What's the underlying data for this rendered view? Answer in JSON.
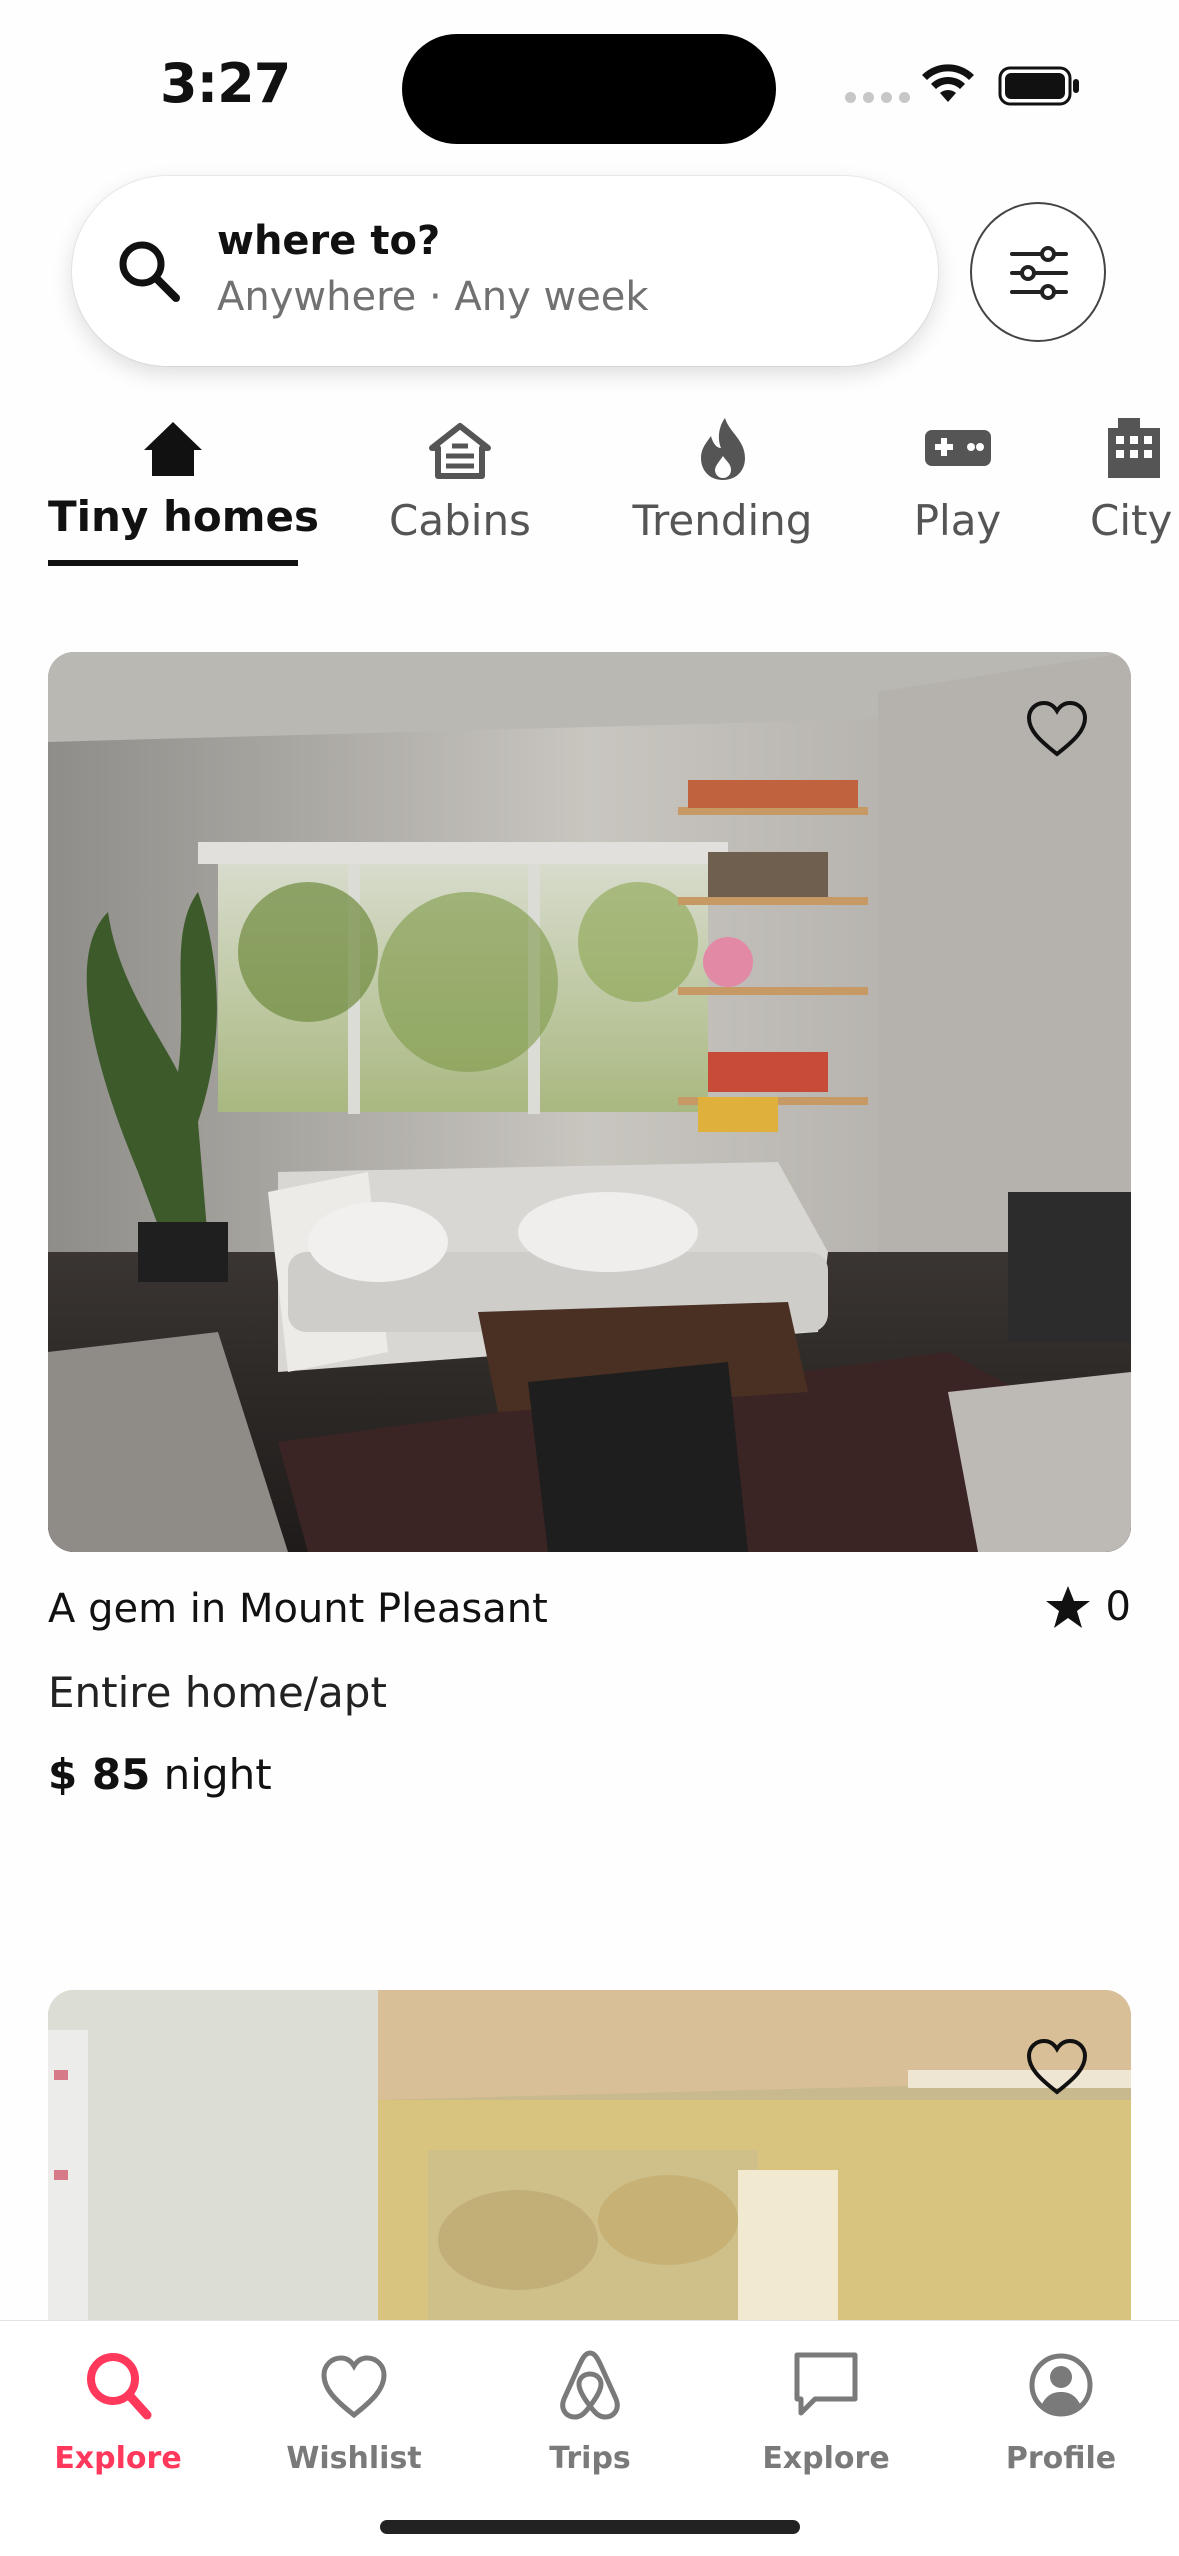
{
  "status_bar": {
    "time": "3:27"
  },
  "search": {
    "title": "where to?",
    "subtitle": "Anywhere · Any week"
  },
  "categories": [
    {
      "label": "Tiny homes",
      "icon": "home-icon",
      "active": true
    },
    {
      "label": "Cabins",
      "icon": "cabin-icon",
      "active": false
    },
    {
      "label": "Trending",
      "icon": "fire-icon",
      "active": false
    },
    {
      "label": "Play",
      "icon": "gamepad-icon",
      "active": false
    },
    {
      "label": "City",
      "icon": "city-icon",
      "active": false
    }
  ],
  "listings": [
    {
      "title": "A gem in Mount Pleasant",
      "rating": "0",
      "room_type": "Entire home/apt",
      "price": "$ 85",
      "price_unit": "night"
    },
    {
      "title": "",
      "rating": "",
      "room_type": "",
      "price": "",
      "price_unit": ""
    }
  ],
  "tab_bar": {
    "tabs": [
      {
        "label": "Explore",
        "icon": "search-icon",
        "active": true
      },
      {
        "label": "Wishlist",
        "icon": "heart-icon",
        "active": false
      },
      {
        "label": "Trips",
        "icon": "airbnb-logo-icon",
        "active": false
      },
      {
        "label": "Explore",
        "icon": "message-icon",
        "active": false
      },
      {
        "label": "Profile",
        "icon": "profile-icon",
        "active": false
      }
    ]
  },
  "colors": {
    "accent": "#ff385c",
    "text_primary": "#111111",
    "text_secondary": "#717171",
    "background": "#fdfefd"
  }
}
